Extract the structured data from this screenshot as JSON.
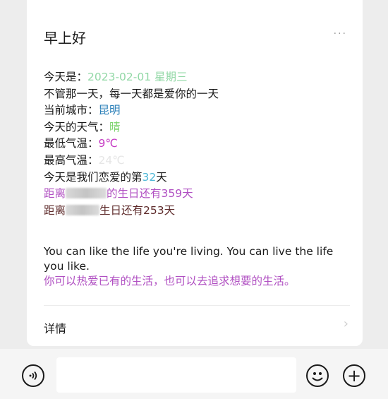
{
  "card": {
    "title": "早上好",
    "more_label": "···",
    "line1_label": "今天是：",
    "line1_value": "2023-02-01 星期三",
    "line2": "不管那一天，每一天都是爱你的一天",
    "line3_label": "当前城市：",
    "line3_value": "昆明",
    "line4_label": "今天的天气：",
    "line4_value": "晴",
    "line5_label": "最低气温：",
    "line5_value": "9℃",
    "line6_label": "最高气温：",
    "line6_value": "24℃",
    "line7_prefix": "今天是我们恋爱的第",
    "line7_number": "32",
    "line7_suffix": "天",
    "line8_prefix": "距离",
    "line8_suffix": "的生日还有359天",
    "line9_prefix": "距离",
    "line9_suffix": "生日还有253天",
    "english": "You can like the life you're living. You can live the life you like.",
    "chinese": "你可以热爱已有的生活，也可以去追求想要的生活。",
    "detail_label": "详情",
    "chevron": "›"
  },
  "bottom": {
    "voice_icon": "voice-icon",
    "emoji_icon": "emoji-icon",
    "plus_icon": "plus-icon",
    "plus_glyph": "+"
  },
  "colors": {
    "date": "#92d8a6",
    "city": "#2a7fb8",
    "weather": "#7bd36b",
    "low": "#c53bc3",
    "high": "#e6e6e6",
    "number": "#4bb6d6",
    "birthday1": "#b04fc2",
    "birthday2": "#5e2b2b",
    "chinese": "#b04fc2"
  }
}
